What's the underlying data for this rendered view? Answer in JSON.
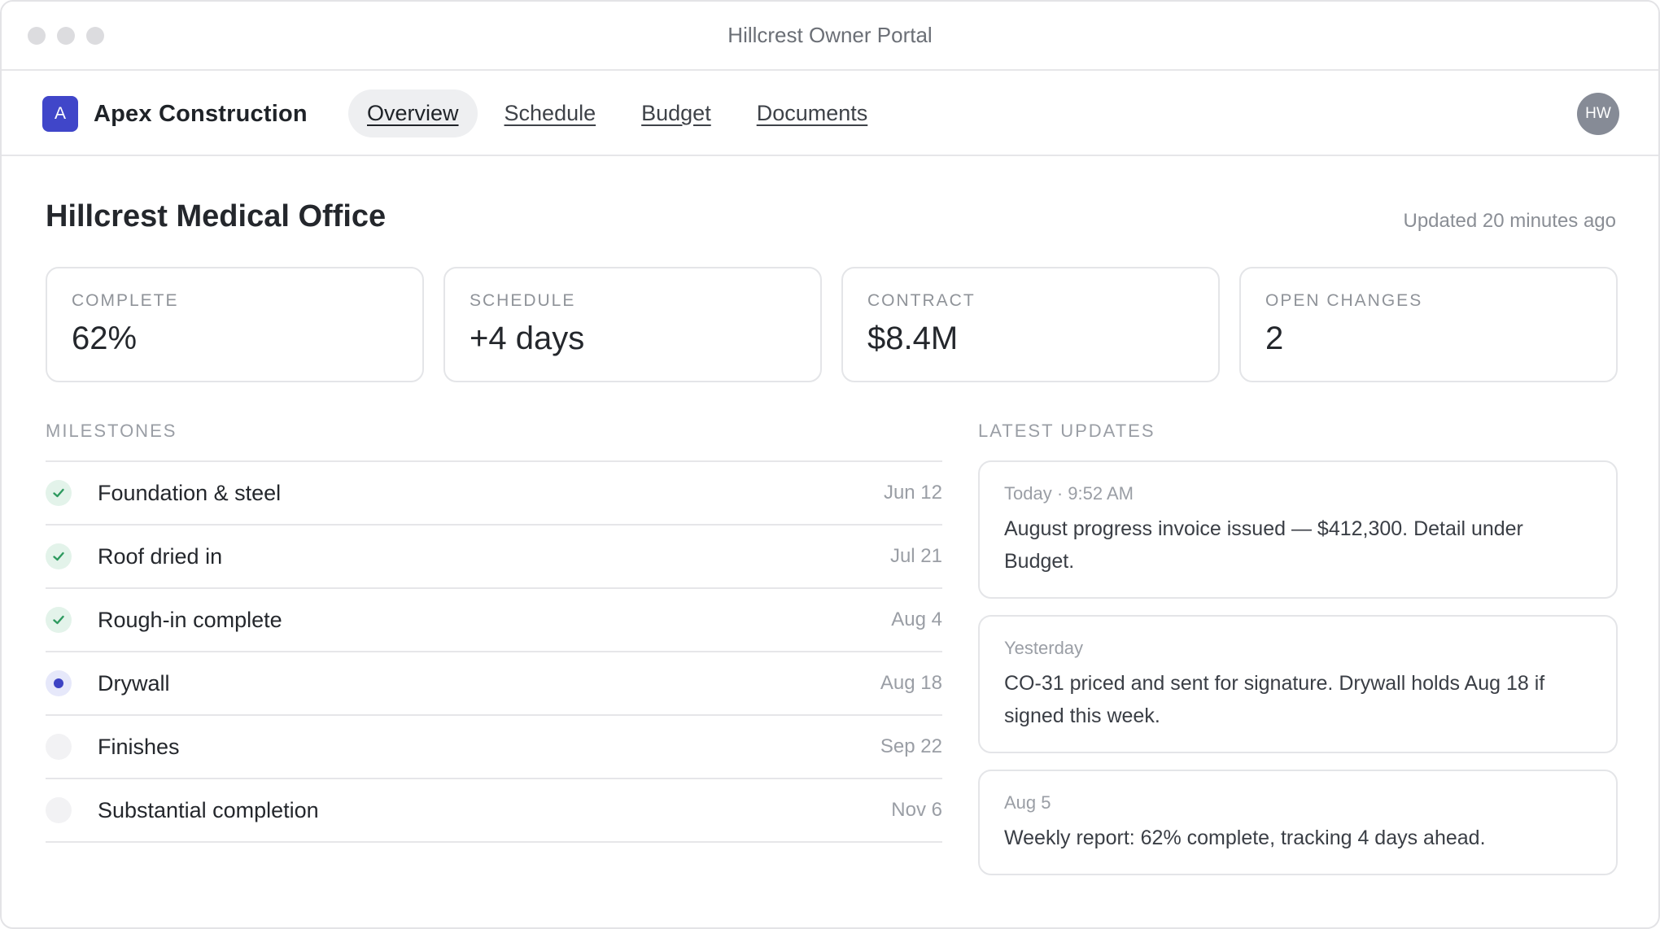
{
  "window": {
    "title": "Hillcrest Owner Portal"
  },
  "nav": {
    "brand_initial": "A",
    "brand_name": "Apex Construction",
    "tabs": [
      {
        "label": "Overview",
        "active": true
      },
      {
        "label": "Schedule",
        "active": false
      },
      {
        "label": "Budget",
        "active": false
      },
      {
        "label": "Documents",
        "active": false
      }
    ],
    "user_initials": "HW"
  },
  "header": {
    "title": "Hillcrest Medical Office",
    "updated": "Updated 20 minutes ago"
  },
  "stats": [
    {
      "label": "COMPLETE",
      "value": "62%"
    },
    {
      "label": "SCHEDULE",
      "value": "+4 days"
    },
    {
      "label": "CONTRACT",
      "value": "$8.4M"
    },
    {
      "label": "OPEN CHANGES",
      "value": "2"
    }
  ],
  "milestones": {
    "label": "MILESTONES",
    "items": [
      {
        "name": "Foundation & steel",
        "date": "Jun 12",
        "status": "done"
      },
      {
        "name": "Roof dried in",
        "date": "Jul 21",
        "status": "done"
      },
      {
        "name": "Rough-in complete",
        "date": "Aug 4",
        "status": "done"
      },
      {
        "name": "Drywall",
        "date": "Aug 18",
        "status": "current"
      },
      {
        "name": "Finishes",
        "date": "Sep 22",
        "status": "pending"
      },
      {
        "name": "Substantial completion",
        "date": "Nov 6",
        "status": "pending"
      }
    ]
  },
  "updates": {
    "label": "LATEST UPDATES",
    "items": [
      {
        "time": "Today · 9:52 AM",
        "text": "August progress invoice issued — $412,300. Detail under Budget."
      },
      {
        "time": "Yesterday",
        "text": "CO-31 priced and sent for signature. Drywall holds Aug 18 if signed this week."
      },
      {
        "time": "Aug 5",
        "text": "Weekly report: 62% complete, tracking 4 days ahead."
      }
    ]
  },
  "colors": {
    "accent": "#4046c9",
    "done": "#2e9a5f",
    "current": "#3d43c4"
  }
}
